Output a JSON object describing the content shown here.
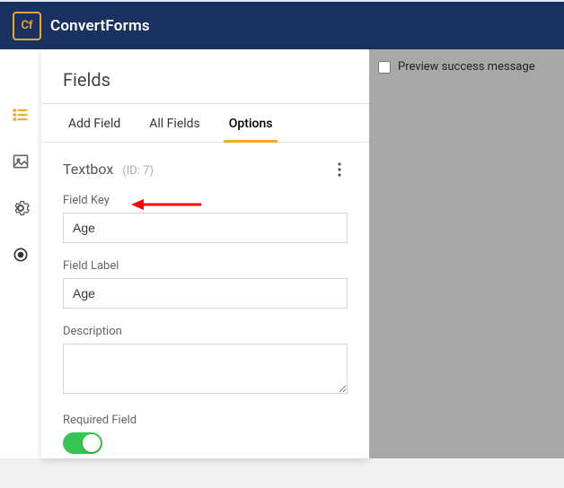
{
  "header": {
    "logo": "Cf",
    "brand": "ConvertForms"
  },
  "panel": {
    "title": "Fields",
    "tabs": {
      "add": "Add Field",
      "all": "All Fields",
      "options": "Options"
    },
    "section": {
      "type": "Textbox",
      "id_label": "(ID: 7)"
    },
    "field_key": {
      "label": "Field Key",
      "value": "Age"
    },
    "field_label": {
      "label": "Field Label",
      "value": "Age"
    },
    "description": {
      "label": "Description",
      "value": ""
    },
    "required": {
      "label": "Required Field"
    }
  },
  "preview": {
    "checkbox_label": "Preview success message"
  }
}
